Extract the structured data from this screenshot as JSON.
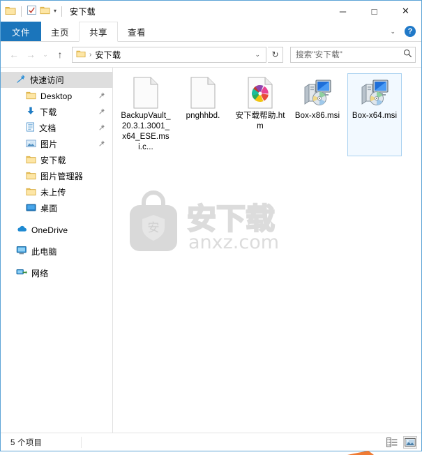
{
  "window": {
    "title": "安下载",
    "border_color": "#5ca3d6",
    "accent_color": "#1b75bb"
  },
  "quick_access_toolbar": {
    "items": [
      {
        "name": "folder-icon",
        "label": ""
      },
      {
        "name": "properties-icon",
        "label": ""
      },
      {
        "name": "new-folder-icon",
        "label": ""
      }
    ],
    "dropdown_glyph": "▾"
  },
  "window_controls": {
    "minimize": "─",
    "maximize": "□",
    "close": "✕"
  },
  "ribbon": {
    "tabs": [
      {
        "label": "文件",
        "state": "selected"
      },
      {
        "label": "主页",
        "state": "normal"
      },
      {
        "label": "共享",
        "state": "hover"
      },
      {
        "label": "查看",
        "state": "normal"
      }
    ],
    "collapse_glyph": "⌄",
    "help_label": "?"
  },
  "addressbar": {
    "back_glyph": "←",
    "forward_glyph": "→",
    "history_glyph": "⌄",
    "up_glyph": "↑",
    "crumb_sep": "›",
    "path": "安下载",
    "dropdown_glyph": "⌄",
    "refresh_glyph": "↻"
  },
  "search": {
    "placeholder": "搜索\"安下载\"",
    "icon_glyph": "⌕"
  },
  "sidebar": {
    "items": [
      {
        "label": "快速访问",
        "icon": "pin-star-icon",
        "level": "root",
        "selected": true,
        "pinned": false
      },
      {
        "label": "Desktop",
        "icon": "folder-icon",
        "level": "child",
        "selected": false,
        "pinned": true
      },
      {
        "label": "下载",
        "icon": "download-icon",
        "level": "child",
        "selected": false,
        "pinned": true
      },
      {
        "label": "文档",
        "icon": "document-icon",
        "level": "child",
        "selected": false,
        "pinned": true
      },
      {
        "label": "图片",
        "icon": "pictures-icon",
        "level": "child",
        "selected": false,
        "pinned": true
      },
      {
        "label": "安下载",
        "icon": "folder-icon",
        "level": "child",
        "selected": false,
        "pinned": false
      },
      {
        "label": "图片管理器",
        "icon": "folder-icon",
        "level": "child",
        "selected": false,
        "pinned": false
      },
      {
        "label": "未上传",
        "icon": "folder-icon",
        "level": "child",
        "selected": false,
        "pinned": false
      },
      {
        "label": "桌面",
        "icon": "desktop-icon",
        "level": "child",
        "selected": false,
        "pinned": false
      },
      {
        "label": "OneDrive",
        "icon": "cloud-icon",
        "level": "root",
        "selected": false,
        "pinned": false,
        "gap_before": true
      },
      {
        "label": "此电脑",
        "icon": "this-pc-icon",
        "level": "root",
        "selected": false,
        "pinned": false,
        "gap_before": true
      },
      {
        "label": "网络",
        "icon": "network-icon",
        "level": "root",
        "selected": false,
        "pinned": false,
        "gap_before": true
      }
    ]
  },
  "files": [
    {
      "name": "BackupVault_20.3.1.3001_x64_ESE.msi.c...",
      "icon": "blank-file-icon",
      "selected": false
    },
    {
      "name": "pnghhbd.",
      "icon": "blank-file-icon",
      "selected": false
    },
    {
      "name": "安下载帮助.htm",
      "icon": "html-chrome-icon",
      "selected": false
    },
    {
      "name": "Box-x86.msi",
      "icon": "msi-installer-icon",
      "selected": false
    },
    {
      "name": "Box-x64.msi",
      "icon": "msi-installer-icon",
      "selected": true
    }
  ],
  "watermark": {
    "text_cn": "安下载",
    "text_domain": "anxz.com",
    "shield_char": "安",
    "color": "#d6d6d6"
  },
  "statusbar": {
    "item_count_text": "5 个项目",
    "view_buttons": [
      {
        "name": "details-view-button",
        "active": false
      },
      {
        "name": "large-icons-view-button",
        "active": true
      }
    ]
  }
}
